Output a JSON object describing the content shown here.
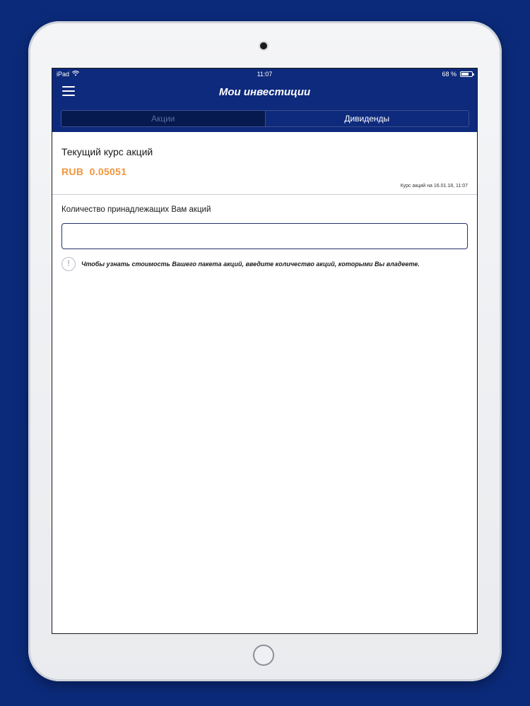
{
  "status_bar": {
    "device": "iPad",
    "wifi_icon": "wifi-icon",
    "time": "11:07",
    "battery_percent": "68 %",
    "battery_level": 0.68
  },
  "nav": {
    "title": "Мои инвестиции",
    "menu_icon": "hamburger-menu-icon"
  },
  "tabs": [
    {
      "label": "Акции",
      "active": true
    },
    {
      "label": "Дивиденды",
      "active": false
    }
  ],
  "rate": {
    "title": "Текущий курс акций",
    "value": "RUB  0.05051",
    "date": "Курс акций на 16.01.18, 11:07"
  },
  "quantity": {
    "label": "Количество принадлежащих Вам акций",
    "value": "",
    "placeholder": ""
  },
  "info": {
    "icon": "exclamation-circle-icon",
    "glyph": "!",
    "text": "Чтобы узнать стоимость Вашего пакета акций, введите количество акций, которыми Вы владеете."
  },
  "colors": {
    "background": "#0b2a7a",
    "header": "#0e2a7c",
    "accent": "#f0953c"
  }
}
